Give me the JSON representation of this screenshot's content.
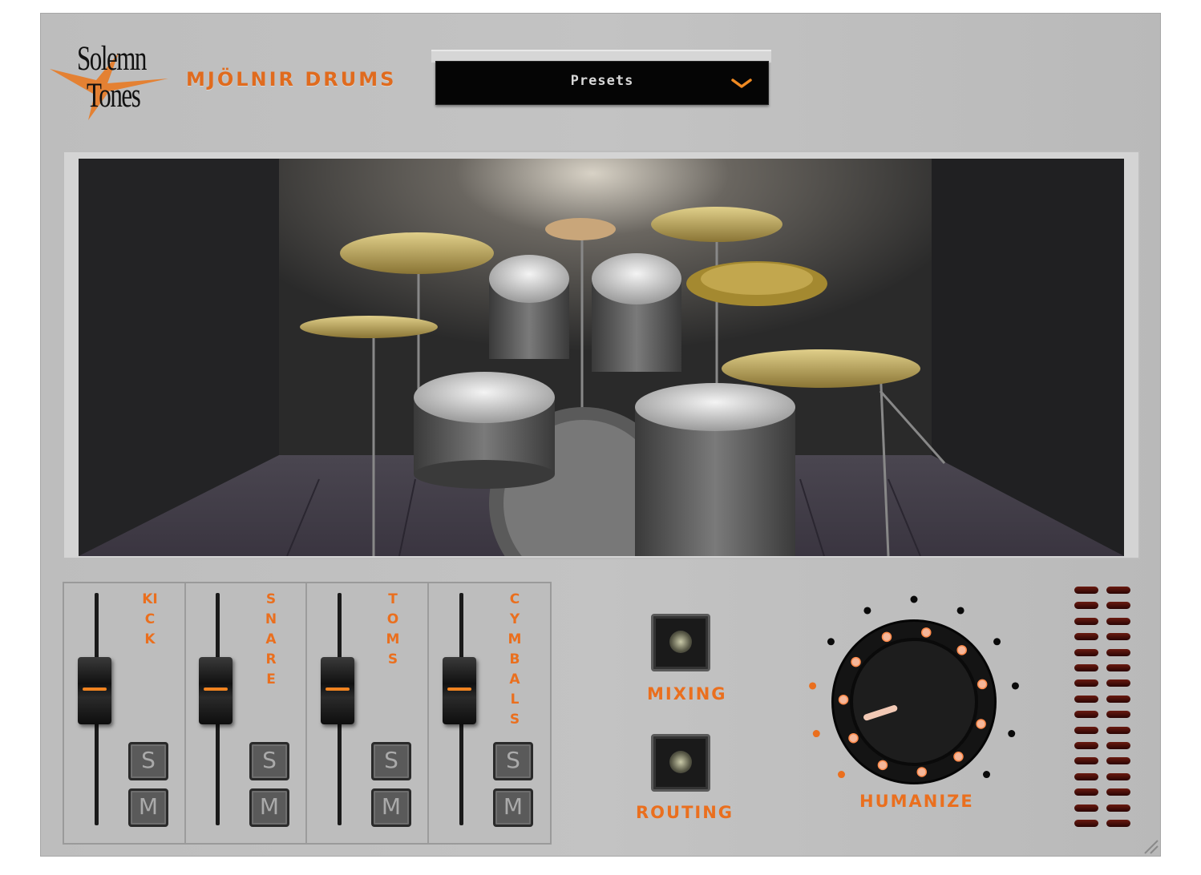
{
  "header": {
    "logo_top": "Solemn",
    "logo_bottom": "Tones",
    "product_name": "MJÖLNIR DRUMS",
    "presets_label": "Presets"
  },
  "mixer": {
    "channels": [
      {
        "label": "KICK",
        "solo": "S",
        "mute": "M",
        "fader_level": 0.65
      },
      {
        "label": "SNARE",
        "solo": "S",
        "mute": "M",
        "fader_level": 0.65
      },
      {
        "label": "TOMS",
        "solo": "S",
        "mute": "M",
        "fader_level": 0.65
      },
      {
        "label": "CYMBALS",
        "solo": "S",
        "mute": "M",
        "fader_level": 0.65
      }
    ]
  },
  "buttons": {
    "mixing_label": "MIXING",
    "routing_label": "ROUTING"
  },
  "humanize": {
    "label": "HUMANIZE",
    "value_fraction": 0.1
  },
  "colors": {
    "accent": "#ea6f1e",
    "panel": "#bfbfbf",
    "dark": "#0a0a0a"
  },
  "icons": {
    "preset_dropdown": "chevron-down-icon",
    "logo": "lightning-star-icon"
  }
}
